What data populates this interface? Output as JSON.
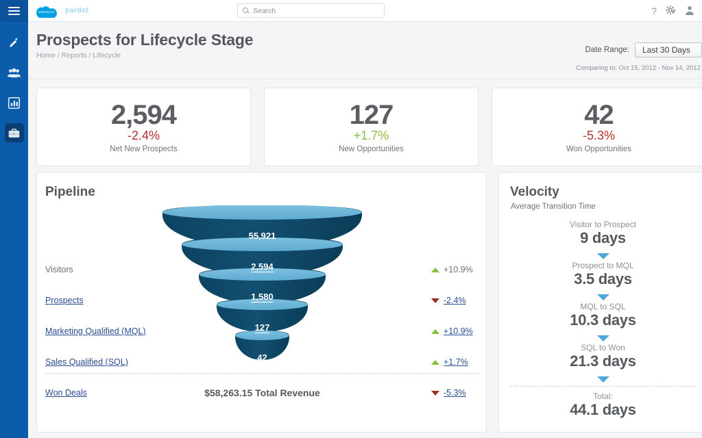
{
  "rail": {
    "menu_icon": "hamburger-menu-icon",
    "items": [
      {
        "name": "wand",
        "glyph": "✒",
        "label": "Marketing"
      },
      {
        "name": "people",
        "glyph": "👥",
        "label": "Prospects"
      },
      {
        "name": "chart",
        "glyph": "📊",
        "label": "Reports"
      },
      {
        "name": "briefcase",
        "glyph": "💼",
        "label": "Business",
        "active": true
      }
    ]
  },
  "topbar": {
    "logo_mark": "salesforce",
    "logo_brand": "pardot",
    "search_placeholder": "Search",
    "search_value": "",
    "help_icon": "?",
    "gear_icon": "⚙",
    "user_icon": "👤"
  },
  "header": {
    "title": "Prospects for Lifecycle Stage",
    "breadcrumb": "Home / Reports / Lifecycle",
    "date_range_label": "Date Range:",
    "date_range_value": "Last 30 Days",
    "comparing_to": "Comparing to: Oct 15, 2012 - Nov 14, 2012"
  },
  "kpis": [
    {
      "value": "2,594",
      "delta": "-2.4%",
      "direction": "down",
      "caption": "Net New Prospects"
    },
    {
      "value": "127",
      "delta": "+1.7%",
      "direction": "up",
      "caption": "New Opportunities"
    },
    {
      "value": "42",
      "delta": "-5.3%",
      "direction": "down",
      "caption": "Won Opportunities"
    }
  ],
  "pipeline": {
    "title": "Pipeline",
    "revenue": "$58,263.15 Total Revenue",
    "stages": [
      {
        "label": "Visitors",
        "is_link": false,
        "value": "55,921",
        "value_link": false,
        "delta": "+10.9%",
        "direction": "up",
        "delta_link": false
      },
      {
        "label": "Prospects",
        "is_link": true,
        "value": "2,594",
        "value_link": true,
        "delta": "-2.4%",
        "direction": "down",
        "delta_link": true
      },
      {
        "label": "Marketing Qualified (MQL)",
        "is_link": true,
        "value": "1,580",
        "value_link": true,
        "delta": "+10.9%",
        "direction": "up",
        "delta_link": true
      },
      {
        "label": "Sales Qualified (SQL)",
        "is_link": true,
        "value": "127",
        "value_link": true,
        "delta": "+1.7%",
        "direction": "up",
        "delta_link": true
      },
      {
        "label": "Won Deals",
        "is_link": true,
        "value": "42",
        "value_link": true,
        "delta": "-5.3%",
        "direction": "down",
        "delta_link": true
      }
    ]
  },
  "velocity": {
    "title": "Velocity",
    "subtitle": "Average Transition Time",
    "steps": [
      {
        "caption": "Visitor to Prospect",
        "value": "9 days"
      },
      {
        "caption": "Prospect to MQL",
        "value": "3.5 days"
      },
      {
        "caption": "MQL to SQL",
        "value": "10.3 days"
      },
      {
        "caption": "SQL to Won",
        "value": "21.3 days"
      }
    ],
    "total_caption": "Total:",
    "total_value": "44.1 days"
  },
  "chart_data": {
    "type": "bar",
    "title": "Pipeline",
    "categories": [
      "Visitors",
      "Prospects",
      "Marketing Qualified (MQL)",
      "Sales Qualified (SQL)",
      "Won Deals"
    ],
    "values": [
      55921,
      2594,
      1580,
      127,
      42
    ],
    "deltas": [
      "+10.9%",
      "-2.4%",
      "+10.9%",
      "+1.7%",
      "-5.3%"
    ],
    "xlabel": "",
    "ylabel": "",
    "legend": [],
    "colors": {
      "segment_top": "#6bb6d8",
      "segment_body": "#0f4b6b",
      "arrow_up": "#8cbf3f",
      "arrow_down": "#9e2b21"
    }
  },
  "colors": {
    "rail_blue": "#0b5cab",
    "accent": "#4fa9d8",
    "positive": "#8cbf3f",
    "negative": "#b0302c",
    "funnel_light": "#6bb6d8",
    "funnel_dark": "#0f4b6b"
  }
}
